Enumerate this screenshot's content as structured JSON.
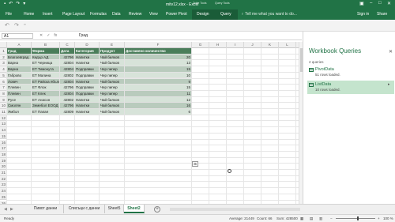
{
  "window": {
    "title": "mitv12.xlsx - Excel",
    "ctx_table_tools": "Table Tools",
    "ctx_query_tools": "Query Tools"
  },
  "ribbon": {
    "tabs": [
      "File",
      "Home",
      "Insert",
      "Page Layout",
      "Formulas",
      "Data",
      "Review",
      "View",
      "Power Pivot",
      "Design",
      "Query"
    ],
    "tell_me": "Tell me what you want to do...",
    "sign_in": "Sign in",
    "share": "Share"
  },
  "formula": {
    "name_box": "A1",
    "value": "Град"
  },
  "columns": [
    "A",
    "B",
    "C",
    "D",
    "E",
    "F",
    "G",
    "H",
    "I",
    "J",
    "K",
    "L",
    "M"
  ],
  "rows": [
    "1",
    "2",
    "3",
    "4",
    "5",
    "6",
    "7",
    "8",
    "9",
    "10",
    "11",
    "12",
    "13",
    "14",
    "15",
    "16",
    "17",
    "18",
    "19",
    "20",
    "21",
    "22",
    "23",
    "24",
    "25",
    "26"
  ],
  "table": {
    "headers": [
      "Град",
      "Фирма",
      "Дата",
      "Категория",
      "Продукт",
      "Доставено количество"
    ],
    "data": [
      [
        "Благоевград",
        "Кедър АД",
        "42796",
        "Напитки",
        "Чай билков",
        "20"
      ],
      [
        "Варна",
        "ЕТ Черница",
        "42804",
        "Напитки",
        "Чай билков",
        "13"
      ],
      [
        "Варна",
        "ЕТ Тимонута",
        "42804",
        "Подправки",
        "Чер пипер",
        "15"
      ],
      [
        "Габрово",
        "ЕТ Малина",
        "42802",
        "Подправки",
        "Чер пипер",
        "10"
      ],
      [
        "Ловеч",
        "ЕТ Райска ябълка",
        "42804",
        "Напитки",
        "Чай билков",
        "9"
      ],
      [
        "Плевен",
        "ЕТ Флок",
        "42796",
        "Подправки",
        "Чер пипер",
        "15"
      ],
      [
        "Плевен",
        "ЕТ Клек",
        "42804",
        "Подправки",
        "Чер пипер",
        "11"
      ],
      [
        "Русе",
        "ЕТ Анасон",
        "42802",
        "Напитки",
        "Чай билков",
        "12"
      ],
      [
        "Смолян",
        "Земебол ЕООД",
        "42796",
        "Напитки",
        "Чай билков",
        "16"
      ],
      [
        "Ямбол",
        "ЕТ Папая",
        "42809",
        "Напитки",
        "Чай билков",
        "6"
      ]
    ]
  },
  "panel": {
    "title": "Workbook Queries",
    "count": "2 queries",
    "queries": [
      {
        "name": "PivotData",
        "rows": "51 rows loaded."
      },
      {
        "name": "ListData",
        "rows": "10 rows loaded."
      }
    ]
  },
  "sheets": [
    "Пивот данни",
    "Списъци с данни",
    "Sheet5",
    "Sheet2"
  ],
  "status": {
    "mode": "Ready",
    "average": "Average: 21449",
    "count": "Count: 66",
    "sum": "Sum: 428500",
    "zoom": "100 %"
  }
}
